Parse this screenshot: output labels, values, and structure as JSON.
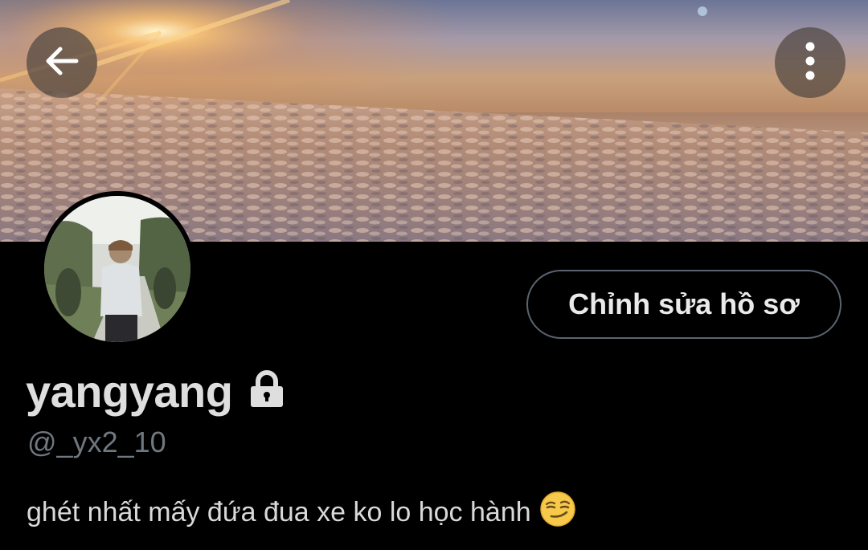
{
  "profile": {
    "display_name": "yangyang",
    "handle": "@_yx2_10",
    "bio_text": "ghét nhất mấy đứa đua xe ko lo học hành",
    "bio_emoji": "smirking-face-emoji",
    "protected": true
  },
  "actions": {
    "edit_profile_label": "Chỉnh sửa hồ sơ"
  },
  "icons": {
    "back": "arrow-left-icon",
    "more": "more-vertical-icon",
    "lock": "lock-icon"
  },
  "colors": {
    "background": "#000000",
    "handle": "#6f7780",
    "button_border": "#5a6470"
  }
}
